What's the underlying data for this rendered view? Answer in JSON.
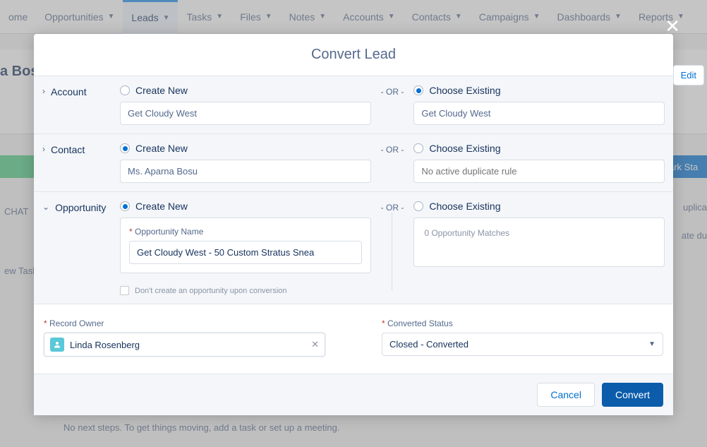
{
  "nav": {
    "items": [
      {
        "label": "ome",
        "hasMenu": false
      },
      {
        "label": "Opportunities",
        "hasMenu": true
      },
      {
        "label": "Leads",
        "hasMenu": true,
        "active": true
      },
      {
        "label": "Tasks",
        "hasMenu": true
      },
      {
        "label": "Files",
        "hasMenu": true
      },
      {
        "label": "Notes",
        "hasMenu": true
      },
      {
        "label": "Accounts",
        "hasMenu": true
      },
      {
        "label": "Contacts",
        "hasMenu": true
      },
      {
        "label": "Campaigns",
        "hasMenu": true
      },
      {
        "label": "Dashboards",
        "hasMenu": true
      },
      {
        "label": "Reports",
        "hasMenu": true
      }
    ]
  },
  "background": {
    "leadName": "a Bos",
    "markStage": "ark Sta",
    "tab": "CHAT",
    "newTask": "ew Task",
    "duplicates": "uplica",
    "duplicates2": "ate du",
    "editBtn": "Edit",
    "noNextSteps": "No next steps. To get things moving, add a task or set up a meeting."
  },
  "modal": {
    "title": "Convert Lead",
    "sections": {
      "account": {
        "label": "Account",
        "createNew": "Create New",
        "chooseExisting": "Choose Existing",
        "newValue": "Get Cloudy West",
        "existingValue": "Get Cloudy West",
        "selected": "existing"
      },
      "contact": {
        "label": "Contact",
        "createNew": "Create New",
        "chooseExisting": "Choose Existing",
        "newValue": "Ms. Aparna Bosu",
        "existingPlaceholder": "No active duplicate rule",
        "selected": "new"
      },
      "opportunity": {
        "label": "Opportunity",
        "createNew": "Create New",
        "chooseExisting": "Choose Existing",
        "nameLabel": "Opportunity Name",
        "nameValue": "Get Cloudy West - 50 Custom Stratus Snea",
        "dontCreate": "Don't create an opportunity upon conversion",
        "matches": "0 Opportunity Matches",
        "selected": "new"
      }
    },
    "or": "- OR -",
    "recordOwner": {
      "label": "Record Owner",
      "value": "Linda Rosenberg"
    },
    "convertedStatus": {
      "label": "Converted Status",
      "value": "Closed - Converted"
    },
    "buttons": {
      "cancel": "Cancel",
      "convert": "Convert"
    }
  }
}
